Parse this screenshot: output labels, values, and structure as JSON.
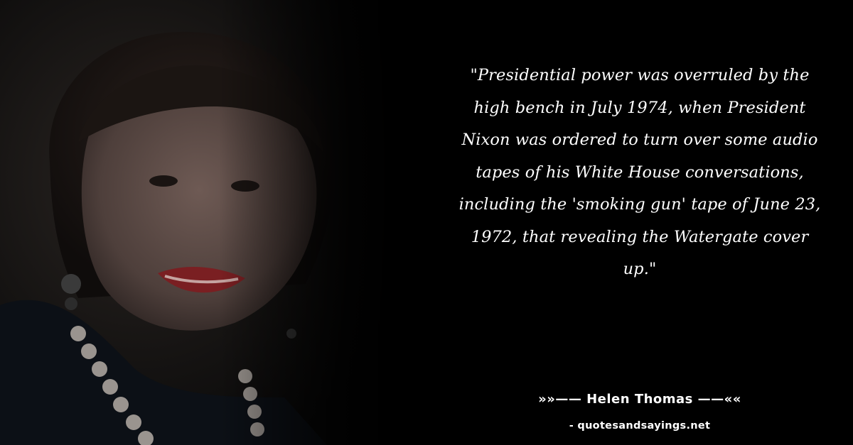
{
  "quote": {
    "text": "\"Presidential power was overruled by the high bench in July 1974, when President Nixon was ordered to turn over some audio tapes of his White House conversations, including the 'smoking gun' tape of June 23, 1972, that revealing the Watergate cover up.\""
  },
  "attribution": {
    "prefix": "»»—— ",
    "author": "Helen Thomas",
    "suffix": " ——««"
  },
  "source": {
    "site": "- quotesandsayings.net"
  },
  "colors": {
    "background": "#000000",
    "text": "#ffffff"
  }
}
